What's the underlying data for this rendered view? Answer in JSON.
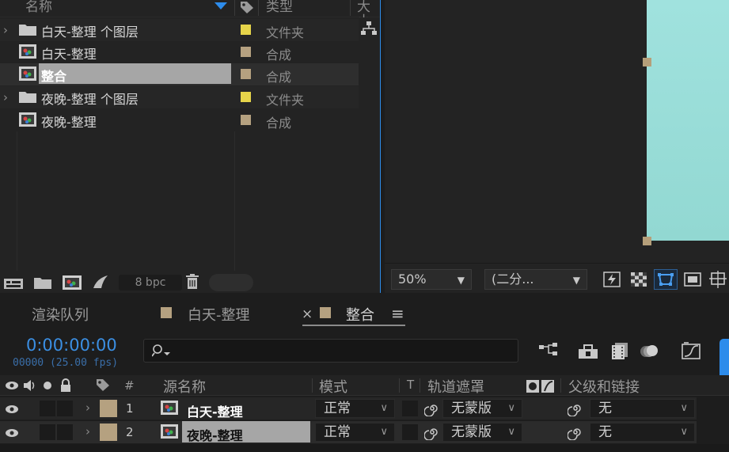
{
  "project": {
    "columns": {
      "name": "名称",
      "type": "类型",
      "size": "大小"
    },
    "items": [
      {
        "name": "白天-整理 个图层",
        "type": "文件夹",
        "kind": "folder",
        "label_color": "#e6d44a",
        "expandable": true
      },
      {
        "name": "白天-整理",
        "type": "合成",
        "kind": "comp",
        "label_color": "#b5a180",
        "expandable": false
      },
      {
        "name": "整合",
        "type": "合成",
        "kind": "comp",
        "label_color": "#b5a180",
        "expandable": false,
        "selected": true
      },
      {
        "name": "夜晚-整理 个图层",
        "type": "文件夹",
        "kind": "folder",
        "label_color": "#e6d44a",
        "expandable": true
      },
      {
        "name": "夜晚-整理",
        "type": "合成",
        "kind": "comp",
        "label_color": "#b5a180",
        "expandable": false
      }
    ],
    "bpc": "8 bpc"
  },
  "viewer": {
    "zoom": "50%",
    "resolution": "(二分...",
    "canvas_color": "#9ee0dc"
  },
  "timeline": {
    "tabs": [
      {
        "label": "渲染队列",
        "swatch": false
      },
      {
        "label": "白天-整理",
        "swatch": true
      },
      {
        "label": "整合",
        "swatch": true,
        "active": true,
        "close": "×"
      }
    ],
    "menu_icon": "≡",
    "timecode": "0:00:00:00",
    "fps": "00000 (25.00 fps)",
    "headers": {
      "num": "#",
      "source": "源名称",
      "mode": "模式",
      "t": "T",
      "matte": "轨道遮罩",
      "parent": "父级和链接"
    },
    "layers": [
      {
        "num": "1",
        "name": "白天-整理",
        "mode": "正常",
        "matte": "无蒙版",
        "parent": "无",
        "selected": false
      },
      {
        "num": "2",
        "name": "夜晚-整理",
        "mode": "正常",
        "matte": "无蒙版",
        "parent": "无",
        "selected": true
      }
    ]
  },
  "colors": {
    "accent": "#2d8ceb",
    "selected_row": "#a6a6a6",
    "comp_label": "#b5a180",
    "folder_label": "#e6d44a"
  }
}
